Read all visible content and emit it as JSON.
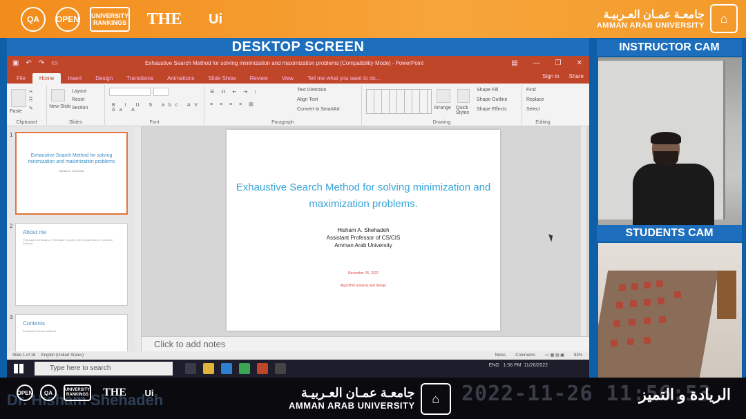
{
  "top_logos": [
    "QA",
    "OPEN",
    "UNIVERSITY RANKINGS",
    "THE",
    "Ui"
  ],
  "university": {
    "arabic": "جامعـة عمـان العـربيـة",
    "english": "AMMAN ARAB UNIVERSITY"
  },
  "panels": {
    "desktop": "DESKTOP SCREEN",
    "instructor": "INSTRUCTOR CAM",
    "students": "STUDENTS CAM"
  },
  "powerpoint": {
    "window_title": "Exhaustive Search Method for solving minimization and maximization problems [Compatibility Mode] - PowerPoint",
    "tabs": [
      "File",
      "Home",
      "Insert",
      "Design",
      "Transitions",
      "Animations",
      "Slide Show",
      "Review",
      "View"
    ],
    "tell_me": "Tell me what you want to do...",
    "signin": "Sign in",
    "share": "Share",
    "ribbon_groups": [
      "Clipboard",
      "Slides",
      "Font",
      "Paragraph",
      "Drawing",
      "Editing"
    ],
    "ribbon_buttons": {
      "paste": "Paste",
      "new_slide": "New Slide",
      "layout": "Layout",
      "reset": "Reset",
      "section": "Section",
      "text_direction": "Text Direction",
      "align_text": "Align Text",
      "convert_smartart": "Convert to SmartArt",
      "arrange": "Arrange",
      "quick_styles": "Quick Styles",
      "shape_fill": "Shape Fill",
      "shape_outline": "Shape Outline",
      "shape_effects": "Shape Effects",
      "find": "Find",
      "replace": "Replace",
      "select": "Select"
    },
    "thumbnails": [
      {
        "num": "1",
        "title": "Exhaustive Search Method for solving minimization and maximization problems"
      },
      {
        "num": "2",
        "title": "About me",
        "body": "This paper is Hisham A. Shehadeh, report of the Department of Computer Science..."
      },
      {
        "num": "3",
        "title": "Contents",
        "body": "Exhaustive Search Method"
      }
    ],
    "slide": {
      "title": "Exhaustive Search Method for solving minimization and maximization problems.",
      "author": "Hisham A. Shehadeh",
      "position": "Assistant Professor of CS/CIS",
      "institution": "Amman Arab University",
      "date": "November 26, 2022",
      "course": "Algorithm analysis and design"
    },
    "notes_placeholder": "Click to add notes",
    "status": {
      "slide_info": "Slide 1 of 16",
      "language": "English (United States)",
      "notes": "Notes",
      "comments": "Comments",
      "zoom": "83%"
    }
  },
  "taskbar": {
    "search_placeholder": "Type here to search",
    "time": "1:56 PM",
    "date": "11/26/2022",
    "lang": "ENG"
  },
  "bottom": {
    "presenter_watermark": "Dr. Hisham Shehadeh",
    "datetime": "2022-11-26  11:56:53",
    "slogan": "الريادة و التميز"
  },
  "colors": {
    "banner": "#f39a2a",
    "panel_blue": "#1d6fbd",
    "ppt_red": "#c0462a",
    "slide_title": "#36a3d9"
  }
}
